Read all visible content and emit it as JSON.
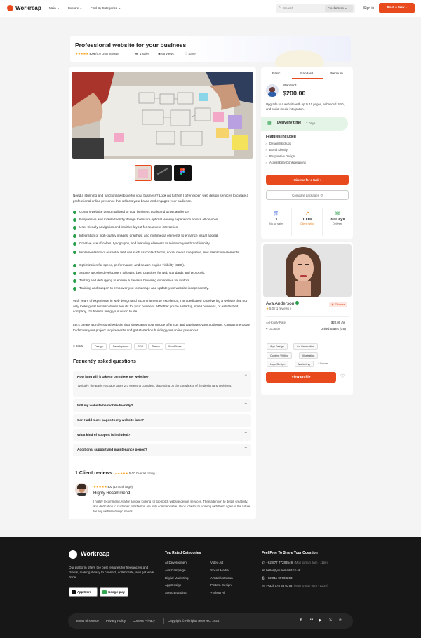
{
  "header": {
    "brand": "Workreap",
    "nav": [
      "Main",
      "Explore",
      "Find By Categories"
    ],
    "search_placeholder": "Search",
    "search_scope": "Freelancers",
    "signin": "Sign in",
    "post_task": "Post a task"
  },
  "service": {
    "title": "Professional website for your business",
    "rating": "5.00",
    "rating_max": "/5.0",
    "review_label": "User review",
    "sales": "1 sales",
    "views": "65 views",
    "save": "Save"
  },
  "description": {
    "intro": "Need a stunning and functional website for your business? Look no further! I offer expert web design services to create a professional online presence that reflects your brand and engages your audience.",
    "features": [
      "Custom website design tailored to your business goals and target audience.",
      "Responsive and mobile-friendly design to ensure optimal viewing experience across all devices.",
      "User-friendly navigation and intuitive layout for seamless interaction.",
      "Integration of high-quality images, graphics, and multimedia elements to enhance visual appeal.",
      "Creative use of colors, typography, and branding elements to reinforce your brand identity.",
      "Implementation of essential features such as contact forms, social media integration, and interactive elements.",
      "Optimization for speed, performance, and search engine visibility (SEO).",
      "Secure website development following best practices for web standards and protocols.",
      "Testing and debugging to ensure a flawless browsing experience for visitors.",
      "Training and support to empower you to manage and update your website independently."
    ],
    "para2": "With years of experience in web design and a commitment to excellence, I am dedicated to delivering a website that not only looks great but also drives results for your business. Whether you're a startup, small business, or established company, I'm here to bring your vision to life.",
    "para3": "Let's create a professional website that showcases your unique offerings and captivates your audience. Contact me today to discuss your project requirements and get started on building your online presence!",
    "tags_label": "Tags:",
    "tags": [
      "Design",
      "Development",
      "SEO",
      "Theme",
      "WordPress"
    ]
  },
  "faq": {
    "heading": "Fequently asked questions",
    "items": [
      {
        "q": "How long will it take to complete my website?",
        "a": "Typically, the Basic Package takes 2-3 weeks to complete, depending on the complexity of the design and revisions.",
        "sign": "−"
      },
      {
        "q": "Will my website be mobile-friendly?",
        "sign": "+"
      },
      {
        "q": "Can I add more pages to my website later?",
        "sign": "+"
      },
      {
        "q": "What kind of support is included?",
        "sign": "+"
      },
      {
        "q": "Additional support and maintenance period?",
        "sign": "+"
      }
    ]
  },
  "reviews": {
    "heading": "1 Client reviews",
    "overall": "5.00 Overall rating.)",
    "item": {
      "score": "5.0",
      "when": "(1 month ago)",
      "title": "Highly Recommend",
      "body": "I highly recommend Ava for anyone looking for top-notch website design services. Their attention to detail, creativity, and dedication to customer satisfaction are truly commendable. I look forward to working with them again in the future for any website design needs."
    }
  },
  "package": {
    "tabs": [
      "Basic",
      "Standard",
      "Premium"
    ],
    "active_tab": "Standard",
    "name": "Standard",
    "price": "$200.00",
    "desc": "Upgrade to a website with up to 10 pages, enhanced SEO, and social media integration.",
    "delivery_label": "Delivery time",
    "delivery_value": "7 Days",
    "features_heading": "Features included",
    "features": [
      "Design Mockups",
      "Brand Identity",
      "Responsive Design",
      "Accessibility Considerations"
    ],
    "hire": "Hire me for a task",
    "compare": "Compare packages",
    "stats": [
      {
        "value": "1",
        "label": "No. of sales"
      },
      {
        "value": "100%",
        "label": "Client rating"
      },
      {
        "value": "30 Days",
        "label": "Delivery"
      }
    ]
  },
  "freelancer": {
    "name": "Ava Anderson",
    "views": "73 views",
    "rating": "5.0",
    "reviews": "( 1 reviews )",
    "hourly_label": "Hourly Rate",
    "hourly_value": "$20.00 /hr",
    "location_label": "Location",
    "location_value": "United States (US)",
    "skills": [
      "App Design",
      "Art Generation",
      "Content Writing",
      "Illustration",
      "Logo Design",
      "Marketing",
      "+1 more"
    ],
    "view_profile": "View profile"
  },
  "footer": {
    "brand": "Workreap",
    "about": "Our platform offers the best features for freelancers and clients, making it easy to connect, collaborate, and get work done",
    "app_store": "App Store",
    "google_play": "Google play",
    "cat_heading": "Top Rated Categories",
    "cats_left": [
      "AI Development",
      "Ads Campaign",
      "Digital Marketing",
      "App Design",
      "Sonic Branding"
    ],
    "cats_right": [
      "Video Art",
      "Social Media",
      "Art & Illustration",
      "Pattern Design",
      "+ Show All"
    ],
    "contact_heading": "Feel Free To Share Your Question",
    "contacts": [
      {
        "value": "+62 877 77283549",
        "note": "(Mon to Sun 9am - 11pm)"
      },
      {
        "value": "hello@youremailid.co.uk",
        "note": ""
      },
      {
        "value": "+62 811 09998263",
        "note": ""
      },
      {
        "value": "(+33) 775 55 6375",
        "note": "(Mon to Sun 9am - 11pm)"
      }
    ],
    "links": [
      "Terms of service",
      "Privacy Policy",
      "Content Privacy"
    ],
    "copyright": "Copyright © All rights reserved. 2024"
  },
  "colors": {
    "accent": "#e84a1e",
    "success": "#2a9d4a",
    "footer": "#171717"
  }
}
